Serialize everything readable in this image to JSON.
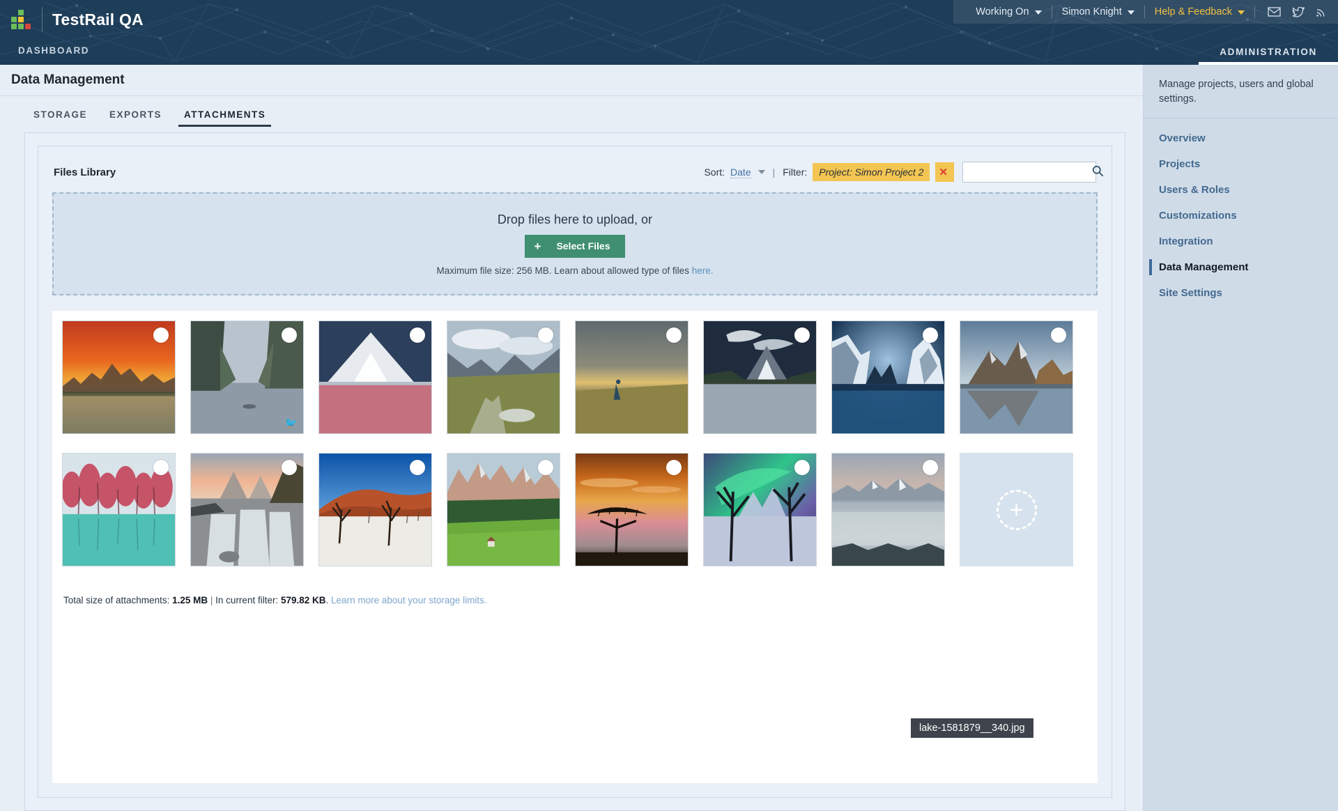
{
  "header": {
    "brand_name": "TestRail QA",
    "dashboard_label": "DASHBOARD",
    "admin_tab_label": "ADMINISTRATION",
    "logo_icon": "testrail-squares-logo-icon",
    "nav": {
      "working_on": "Working On",
      "user_name": "Simon Knight",
      "help": "Help & Feedback",
      "icons": [
        "mail-icon",
        "twitter-icon",
        "rss-icon"
      ]
    }
  },
  "page": {
    "title": "Data Management",
    "tabs": [
      {
        "label": "STORAGE",
        "active": false
      },
      {
        "label": "EXPORTS",
        "active": false
      },
      {
        "label": "ATTACHMENTS",
        "active": true
      }
    ]
  },
  "library": {
    "title": "Files Library",
    "sort_label": "Sort:",
    "sort_value": "Date",
    "separator": "|",
    "filter_label": "Filter:",
    "filter_chip": "Project: Simon Project 2",
    "filter_remove": "✕",
    "search_value": "",
    "search_placeholder": ""
  },
  "dropzone": {
    "title": "Drop files here to upload, or",
    "button_label": "Select Files",
    "button_plus": "+",
    "note_prefix": "Maximum file size: 256 MB. Learn about allowed type of files ",
    "note_link": "here."
  },
  "tooltip": {
    "text": "lake-1581879__340.jpg"
  },
  "add_tile": {
    "plus": "+",
    "icon": "add-attachment-icon"
  },
  "footer": {
    "total_label": "Total size of attachments:",
    "total_value": "1.25 MB",
    "divider": "|",
    "filter_label": "In current filter:",
    "filter_value": "579.82 KB",
    "period": ".",
    "link": "Learn more about your storage limits."
  },
  "sidebar": {
    "description": "Manage projects, users and global settings.",
    "items": [
      {
        "label": "Overview",
        "active": false
      },
      {
        "label": "Projects",
        "active": false
      },
      {
        "label": "Users & Roles",
        "active": false
      },
      {
        "label": "Customizations",
        "active": false
      },
      {
        "label": "Integration",
        "active": false
      },
      {
        "label": "Data Management",
        "active": true
      },
      {
        "label": "Site Settings",
        "active": false
      }
    ]
  },
  "colors": {
    "header_bg": "#1e3d58",
    "accent_gold": "#f0c040",
    "filter_chip_bg": "#f3c552",
    "button_green": "#3f8f70",
    "sidebar_bg": "#cfdce8",
    "link_blue": "#5b8fc2",
    "page_bg": "#e8eef6"
  },
  "thumbnails": [
    {
      "name": "sunset-karst-river-thumbnail",
      "selected": false,
      "badge": ""
    },
    {
      "name": "fjord-lake-thumbnail",
      "selected": false,
      "badge": "twitter-bird"
    },
    {
      "name": "pink-lake-snowy-mountain-thumbnail",
      "selected": false,
      "badge": ""
    },
    {
      "name": "alpine-meadow-stream-thumbnail",
      "selected": false,
      "badge": ""
    },
    {
      "name": "hiker-golden-hills-thumbnail",
      "selected": false,
      "badge": ""
    },
    {
      "name": "volcano-lake-clouds-thumbnail",
      "selected": false,
      "badge": ""
    },
    {
      "name": "winter-valley-reflection-thumbnail",
      "selected": false,
      "badge": ""
    },
    {
      "name": "mountain-reflection-lake-thumbnail",
      "selected": false,
      "badge": ""
    },
    {
      "name": "red-forest-teal-water-thumbnail",
      "selected": false,
      "badge": ""
    },
    {
      "name": "waterfall-autumn-peaks-thumbnail",
      "selected": false,
      "badge": ""
    },
    {
      "name": "desert-dunes-dead-trees-thumbnail",
      "selected": false,
      "badge": ""
    },
    {
      "name": "dolomites-green-valley-thumbnail",
      "selected": false,
      "badge": ""
    },
    {
      "name": "acacia-tree-sunset-thumbnail",
      "selected": false,
      "badge": ""
    },
    {
      "name": "aurora-borealis-trees-thumbnail",
      "selected": false,
      "badge": ""
    },
    {
      "name": "misty-mountain-range-thumbnail",
      "selected": false,
      "badge": ""
    }
  ]
}
